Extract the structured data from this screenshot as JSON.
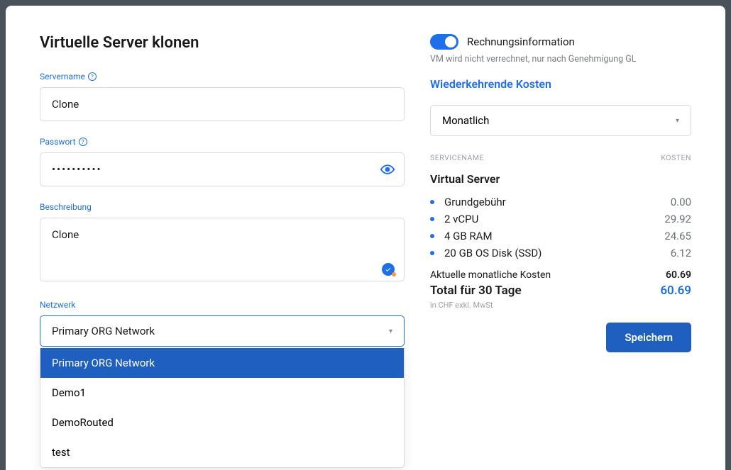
{
  "title": "Virtuelle Server klonen",
  "form": {
    "servername_label": "Servername",
    "servername_value": "Clone",
    "password_label": "Passwort",
    "password_value": "••••••••••",
    "description_label": "Beschreibung",
    "description_value": "Clone",
    "network_label": "Netzwerk",
    "network_selected": "Primary ORG Network",
    "network_options": [
      "Primary ORG Network",
      "Demo1",
      "DemoRouted",
      "test"
    ]
  },
  "billing": {
    "toggle_label": "Rechnungsinformation",
    "toggle_sub": "VM wird nicht verrechnet, nur nach Genehmigung GL",
    "recurring_title": "Wiederkehrende Kosten",
    "period": "Monatlich",
    "header_servicename": "SERVICENAME",
    "header_cost": "KOSTEN",
    "service_name": "Virtual Server",
    "lines": [
      {
        "label": "Grundgebühr",
        "value": "0.00"
      },
      {
        "label": "2 vCPU",
        "value": "29.92"
      },
      {
        "label": "4 GB RAM",
        "value": "24.65"
      },
      {
        "label": "20 GB OS Disk (SSD)",
        "value": "6.12"
      }
    ],
    "current_label": "Aktuelle monatliche Kosten",
    "current_value": "60.69",
    "total_label": "Total für 30 Tage",
    "total_value": "60.69",
    "currency_note": "in CHF exkl. MwSt"
  },
  "actions": {
    "save": "Speichern"
  }
}
